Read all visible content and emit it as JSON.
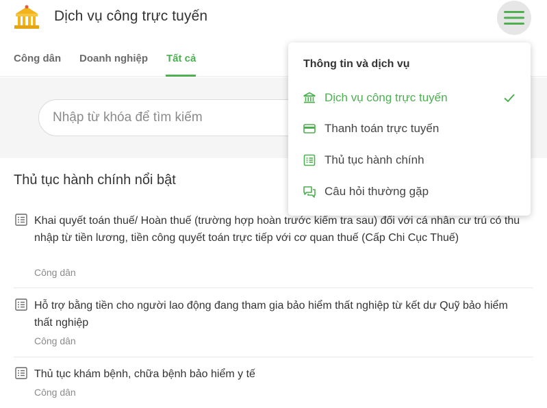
{
  "header": {
    "title": "Dịch vụ công trực tuyến",
    "logo_icon": "government-building-icon",
    "menu_icon": "hamburger-menu-icon"
  },
  "tabs": [
    {
      "label": "Công dân",
      "active": false
    },
    {
      "label": "Doanh nghiệp",
      "active": false
    },
    {
      "label": "Tất cả",
      "active": true
    }
  ],
  "search": {
    "placeholder": "Nhập từ khóa để tìm kiếm",
    "value": ""
  },
  "section": {
    "title": "Thủ tục hành chính nổi bật"
  },
  "items": [
    {
      "title": "Khai quyết toán thuế/ Hoàn thuế (trường hợp hoàn trước kiểm tra sau) đối với cá nhân cư trú có thu nhập từ tiền lương, tiền công quyết toán trực tiếp với cơ quan thuế (Cấp Chi Cục Thuế)",
      "category": "Công dân",
      "icon": "document-list-icon"
    },
    {
      "title": "Hỗ trợ bằng tiền cho người lao động đang tham gia bảo hiểm thất nghiệp từ kết dư Quỹ bảo hiểm thất nghiệp",
      "category": "Công dân",
      "icon": "document-list-icon"
    },
    {
      "title": "Thủ tục khám bệnh, chữa bệnh bảo hiểm y tế",
      "category": "Công dân",
      "icon": "document-list-icon"
    }
  ],
  "dropdown": {
    "title": "Thông tin và dịch vụ",
    "items": [
      {
        "label": "Dịch vụ công trực tuyến",
        "icon": "bank-building-icon",
        "active": true
      },
      {
        "label": "Thanh toán trực tuyến",
        "icon": "credit-card-icon",
        "active": false
      },
      {
        "label": "Thủ tục hành chính",
        "icon": "document-list-icon",
        "active": false
      },
      {
        "label": "Câu hỏi thường gặp",
        "icon": "chat-bubbles-icon",
        "active": false
      }
    ],
    "check_icon": "checkmark-icon"
  },
  "colors": {
    "accent": "#4caf50",
    "text": "#333333",
    "muted": "#8a8a8a",
    "search_bg": "#f5f5f5"
  }
}
